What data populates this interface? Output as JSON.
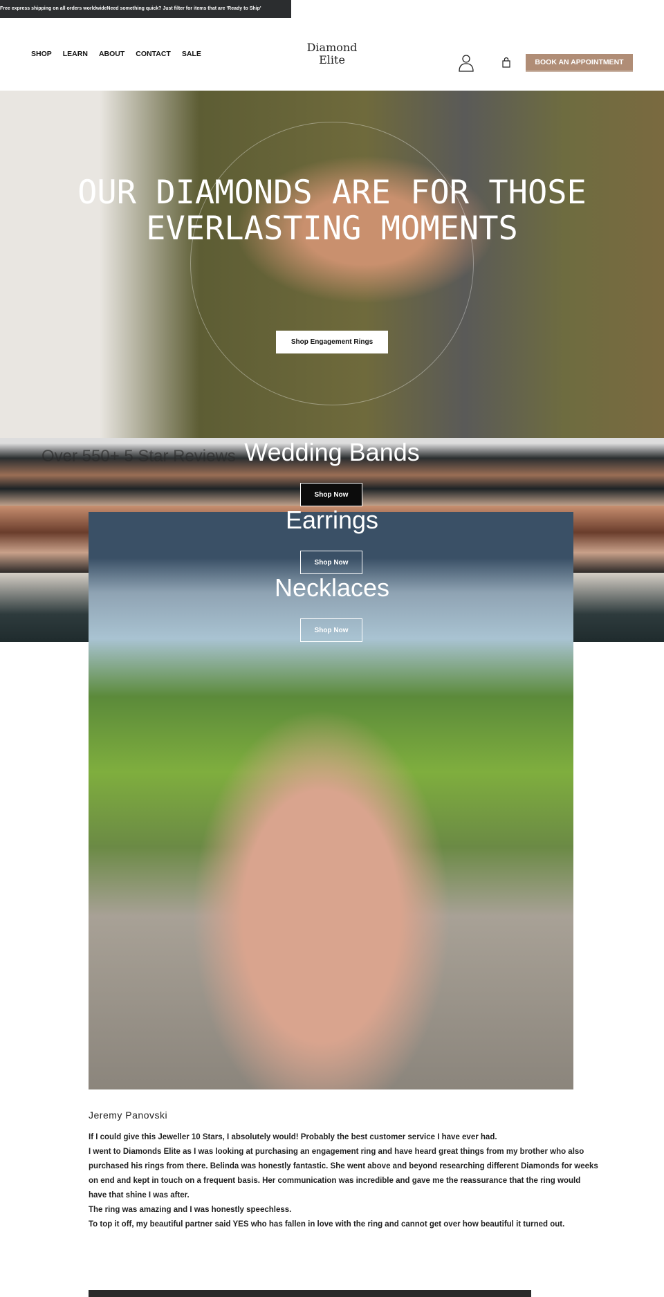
{
  "announcement": "Free express shipping on all orders worldwideNeed something quick? Just filter for items that are 'Ready to Ship'",
  "nav": [
    "SHOP",
    "LEARN",
    "ABOUT",
    "CONTACT",
    "SALE"
  ],
  "logo": {
    "line1": "Diamond",
    "line2": "Elite"
  },
  "header": {
    "account_icon": "user-icon",
    "cart_icon": "shopping-bag-icon",
    "book_label": "BOOK AN APPOINTMENT",
    "accent": "#b08d76"
  },
  "hero": {
    "title": "OUR DIAMONDS ARE FOR THOSE EVERLASTING MOMENTS",
    "cta": "Shop Engagement Rings"
  },
  "reviews": {
    "title": "Over 550+ 5 Star Reviews"
  },
  "categories": [
    {
      "title": "Wedding Bands",
      "cta": "Shop Now"
    },
    {
      "title": "Earrings",
      "cta": "Shop Now"
    },
    {
      "title": "Necklaces",
      "cta": "Shop Now"
    }
  ],
  "review": {
    "name": "Jeremy Panovski",
    "paragraphs": [
      "If I could give this Jeweller 10 Stars, I absolutely would! Probably the best customer service I have ever had.",
      "I went to Diamonds Elite as I was looking at purchasing an engagement ring and have heard great things from my brother who also purchased his rings from there. Belinda was honestly fantastic. She went above and beyond researching different Diamonds for weeks on end and kept in touch on a frequent basis. Her communication was incredible and gave me the reassurance that the ring would have that shine I was after.",
      "The ring was amazing and I was honestly speechless.",
      "To top it off, my beautiful partner said YES who has fallen in love with the ring and cannot get over how beautiful it turned out."
    ]
  }
}
